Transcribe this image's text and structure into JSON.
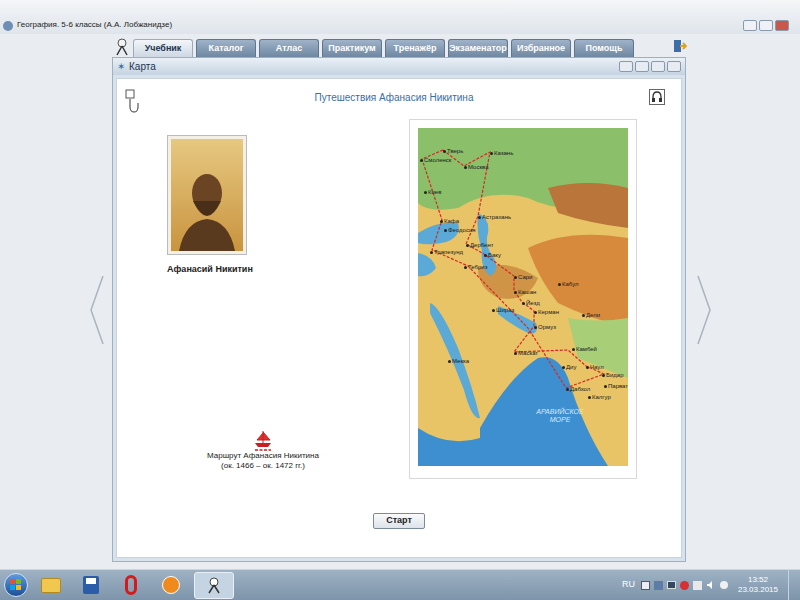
{
  "window": {
    "title": "География. 5-6 классы (А.А. Лобжанидзе)"
  },
  "tabs": [
    {
      "label": "Учебник",
      "selected": true
    },
    {
      "label": "Каталог",
      "selected": false
    },
    {
      "label": "Атлас",
      "selected": false
    },
    {
      "label": "Практикум",
      "selected": false
    },
    {
      "label": "Тренажёр",
      "selected": false
    },
    {
      "label": "Экзаменатор",
      "selected": false
    },
    {
      "label": "Избранное",
      "selected": false
    },
    {
      "label": "Помощь",
      "selected": false
    }
  ],
  "panel": {
    "title": "Карта"
  },
  "lesson": {
    "title": "Путешествия Афанасия Никитина",
    "portrait_caption": "Афанасий Никитин",
    "legend": [
      "Маршрут Афанасия Никитина",
      "(ок. 1466 – ок. 1472 гг.)"
    ],
    "start_button": "Старт"
  },
  "map": {
    "labels": [
      "Тверь",
      "Смоленск",
      "Москва",
      "Казань",
      "Киев",
      "Астрахань",
      "Кафа",
      "Феодосия",
      "Трапезунд",
      "Дербент",
      "Баку",
      "Тебриз",
      "Сари",
      "Кабул",
      "Кашан",
      "Йезд",
      "Шираз",
      "Керман",
      "Ормуз",
      "Дели",
      "Мекка",
      "Маскат",
      "Камбей",
      "Диу",
      "Чаул",
      "Бидар",
      "Дабхол",
      "Парват",
      "Калгур"
    ],
    "sea": "АРАВИЙСКОЕ МОРЕ"
  },
  "taskbar": {
    "language": "RU",
    "time": "13:52",
    "date": "23.03.2015"
  }
}
